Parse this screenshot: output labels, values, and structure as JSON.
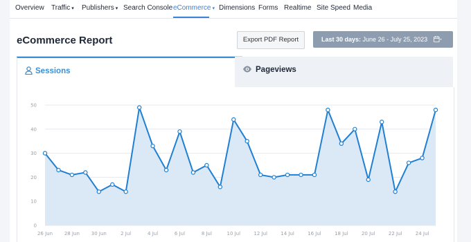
{
  "nav": {
    "items": [
      {
        "label": "Overview",
        "caret": false,
        "active": false
      },
      {
        "label": "Traffic",
        "caret": true,
        "active": false
      },
      {
        "label": "Publishers",
        "caret": true,
        "active": false
      },
      {
        "label": "Search Console",
        "caret": false,
        "active": false
      },
      {
        "label": "eCommerce",
        "caret": true,
        "active": true
      },
      {
        "label": "Dimensions",
        "caret": false,
        "active": false
      },
      {
        "label": "Forms",
        "caret": false,
        "active": false
      },
      {
        "label": "Realtime",
        "caret": false,
        "active": false
      },
      {
        "label": "Site Speed",
        "caret": false,
        "active": false
      },
      {
        "label": "Media",
        "caret": false,
        "active": false
      }
    ],
    "caret_glyph": "▾"
  },
  "report": {
    "title": "eCommerce Report",
    "export_label": "Export PDF Report",
    "date_prefix": "Last 30 days:",
    "date_range": "June 26 - July 25, 2023",
    "calendar_icon": "calendar-icon"
  },
  "tabs": {
    "sessions_label": "Sessions",
    "pageviews_label": "Pageviews",
    "sessions_icon": "user-icon",
    "pageviews_icon": "eye-icon"
  },
  "colors": {
    "accent": "#3a8fd6",
    "line": "#1f7fd2",
    "area": "#dbe8f6",
    "grid": "#e4e8ee",
    "date_button": "#8d9cae"
  },
  "chart_data": {
    "type": "area",
    "title": "",
    "xlabel": "",
    "ylabel": "",
    "ylim": [
      0,
      50
    ],
    "yticks": [
      0,
      10,
      20,
      30,
      40,
      50
    ],
    "grid": true,
    "x": [
      "26 Jun",
      "27 Jun",
      "28 Jun",
      "29 Jun",
      "30 Jun",
      "1 Jul",
      "2 Jul",
      "3 Jul",
      "4 Jul",
      "5 Jul",
      "6 Jul",
      "7 Jul",
      "8 Jul",
      "9 Jul",
      "10 Jul",
      "11 Jul",
      "12 Jul",
      "13 Jul",
      "14 Jul",
      "15 Jul",
      "16 Jul",
      "17 Jul",
      "18 Jul",
      "19 Jul",
      "20 Jul",
      "21 Jul",
      "22 Jul",
      "23 Jul",
      "24 Jul",
      "25 Jul"
    ],
    "xtick_labels": [
      "26 Jun",
      "28 Jun",
      "30 Jun",
      "2 Jul",
      "4 Jul",
      "6 Jul",
      "8 Jul",
      "10 Jul",
      "12 Jul",
      "14 Jul",
      "16 Jul",
      "18 Jul",
      "20 Jul",
      "22 Jul",
      "24 Jul"
    ],
    "series": [
      {
        "values": [
          30,
          23,
          21,
          22,
          14,
          17,
          14,
          49,
          33,
          23,
          39,
          22,
          25,
          16,
          44,
          35,
          21,
          20,
          21,
          21,
          21,
          48,
          34,
          40,
          19,
          43,
          14,
          26,
          28,
          48
        ]
      }
    ]
  }
}
